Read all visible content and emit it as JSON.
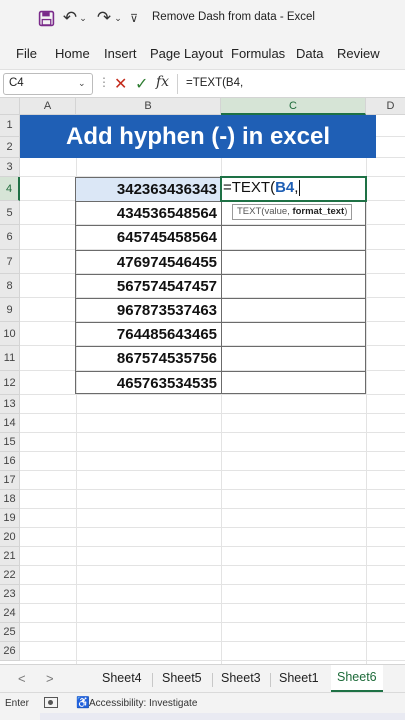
{
  "titlebar": {
    "title": "Remove Dash from data  -  Excel",
    "icons": [
      "save-icon",
      "undo-icon",
      "redo-icon",
      "quick-access-more-icon"
    ],
    "undo_glyph": "↶",
    "redo_glyph": "↷",
    "dropdown_glyph": "⌄",
    "more_glyph": "⊽"
  },
  "ribbon": {
    "tabs": [
      "File",
      "Home",
      "Insert",
      "Page Layout",
      "Formulas",
      "Data",
      "Review"
    ]
  },
  "formula_bar": {
    "name_box": "C4",
    "name_box_arrow": "⌄",
    "dots": "⋮",
    "cancel": "✕",
    "enter": "✓",
    "fx": "fx",
    "formula": "=TEXT(B4,"
  },
  "grid": {
    "columns": [
      "A",
      "B",
      "C",
      "D"
    ],
    "rows": [
      "1",
      "2",
      "3",
      "4",
      "5",
      "6",
      "7",
      "8",
      "9",
      "10",
      "11",
      "12",
      "13",
      "14",
      "15",
      "16",
      "17",
      "18",
      "19",
      "20",
      "21",
      "22",
      "23",
      "24",
      "25",
      "26"
    ],
    "active_column": "C",
    "active_row": "4",
    "banner": "Add hyphen (-)  in excel",
    "banner_color": "#1f5fb5",
    "numbers": [
      "342363436343",
      "434536548564",
      "645745458564",
      "476974546455",
      "567574547457",
      "967873537463",
      "764485643465",
      "867574535756",
      "465763534535"
    ],
    "active_cell": {
      "prefix": "=TEXT(",
      "ref": "B4",
      "suffix": ","
    },
    "tooltip": {
      "func": "TEXT(value, ",
      "bold_arg": "format_text",
      "close": ")"
    }
  },
  "sheets": {
    "nav_prev": "<",
    "nav_next": ">",
    "tabs": [
      "Sheet4",
      "Sheet5",
      "Sheet3",
      "Sheet1",
      "Sheet6"
    ],
    "active": "Sheet6",
    "accent_color": "#1e7145"
  },
  "status": {
    "mode": "Enter",
    "accessibility_glyph": "♿",
    "accessibility": "Accessibility: Investigate"
  }
}
